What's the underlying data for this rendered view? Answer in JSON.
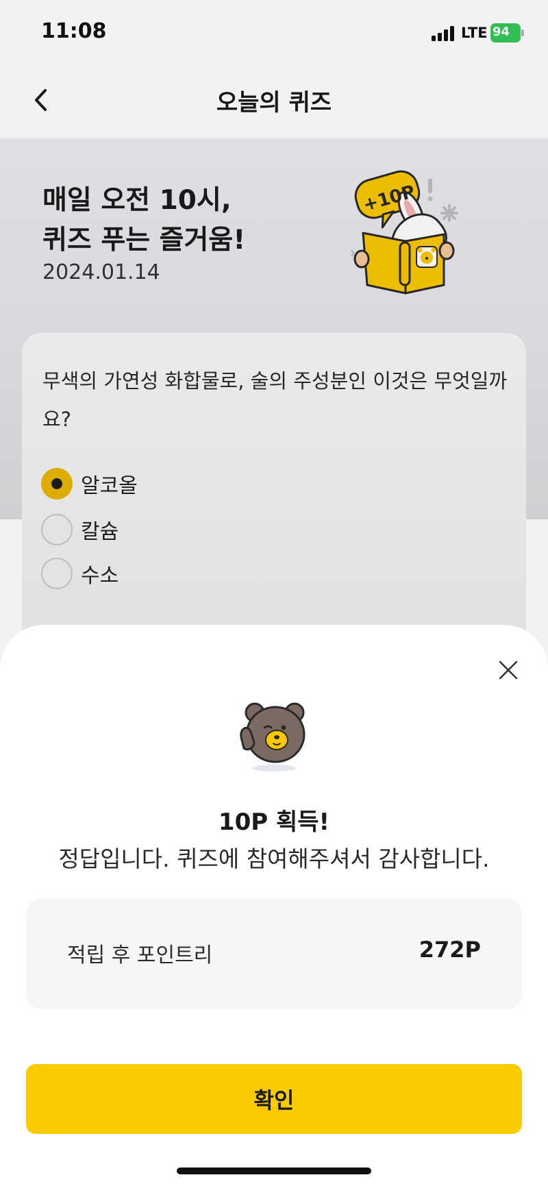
{
  "status_bar": {
    "time": "11:08",
    "network": "LTE",
    "battery": "94"
  },
  "nav": {
    "title": "오늘의 퀴즈"
  },
  "hero": {
    "headline_line1": "매일 오전 10시,",
    "headline_line2": "퀴즈 푸는 즐거움!",
    "date": "2024.01.14",
    "badge_text": "+10P"
  },
  "quiz": {
    "question": "무색의 가연성 화합물로, 술의 주성분인 이것은 무엇일까요?",
    "options": [
      {
        "label": "알코올",
        "selected": true
      },
      {
        "label": "칼슘",
        "selected": false
      },
      {
        "label": "수소",
        "selected": false
      }
    ]
  },
  "sheet": {
    "title": "10P 획득!",
    "message": "정답입니다. 퀴즈에 참여해주셔서 감사합니다.",
    "points_label": "적립 후 포인트리",
    "points_value": "272P",
    "confirm_label": "확인"
  },
  "icons": {
    "back": "chevron-left-icon",
    "close": "close-icon",
    "signal": "signal-icon",
    "battery": "battery-icon"
  },
  "colors": {
    "accent": "#f9cb00",
    "radio_selected": "#e9b800",
    "battery": "#34c759"
  }
}
